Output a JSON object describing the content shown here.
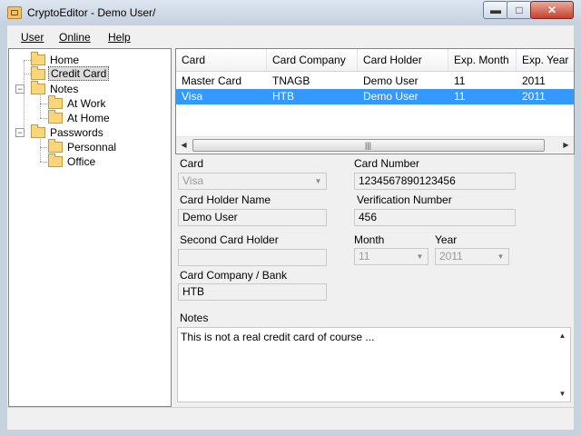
{
  "window": {
    "title": "CryptoEditor - Demo User/",
    "minimize": "▬",
    "maximize": "□",
    "close": "✕"
  },
  "menu": {
    "items": [
      {
        "label": "User"
      },
      {
        "label": "Online"
      },
      {
        "label": "Help"
      }
    ]
  },
  "tree": {
    "home": "Home",
    "credit_card": "Credit Card",
    "notes": "Notes",
    "at_work": "At Work",
    "at_home": "At Home",
    "passwords": "Passwords",
    "personnal": "Personnal",
    "office": "Office",
    "expander_minus": "−"
  },
  "table": {
    "columns": [
      "Card",
      "Card Company",
      "Card Holder",
      "Exp. Month",
      "Exp. Year"
    ],
    "rows": [
      [
        "Master Card",
        "TNAGB",
        "Demo User",
        "11",
        "2011"
      ],
      [
        "Visa",
        "HTB",
        "Demo User",
        "11",
        "2011"
      ]
    ],
    "selected_row": 1,
    "scroll_left": "◀",
    "scroll_right": "▶",
    "scroll_grip": "|||"
  },
  "form": {
    "card_label": "Card",
    "card_value": "Visa",
    "card_number_label": "Card Number",
    "card_number_value": "1234567890123456",
    "holder_label": "Card Holder Name",
    "holder_value": "Demo User",
    "verification_label": "Verification Number",
    "verification_value": "456",
    "second_holder_label": "Second Card Holder",
    "second_holder_value": "",
    "month_label": "Month",
    "month_value": "11",
    "year_label": "Year",
    "year_value": "2011",
    "company_label": "Card Company / Bank",
    "company_value": "HTB",
    "notes_label": "Notes",
    "notes_value": "This is not a real credit card of course ...",
    "dropdown_arrow": "▼",
    "scroll_up": "▲",
    "scroll_down": "▼"
  }
}
